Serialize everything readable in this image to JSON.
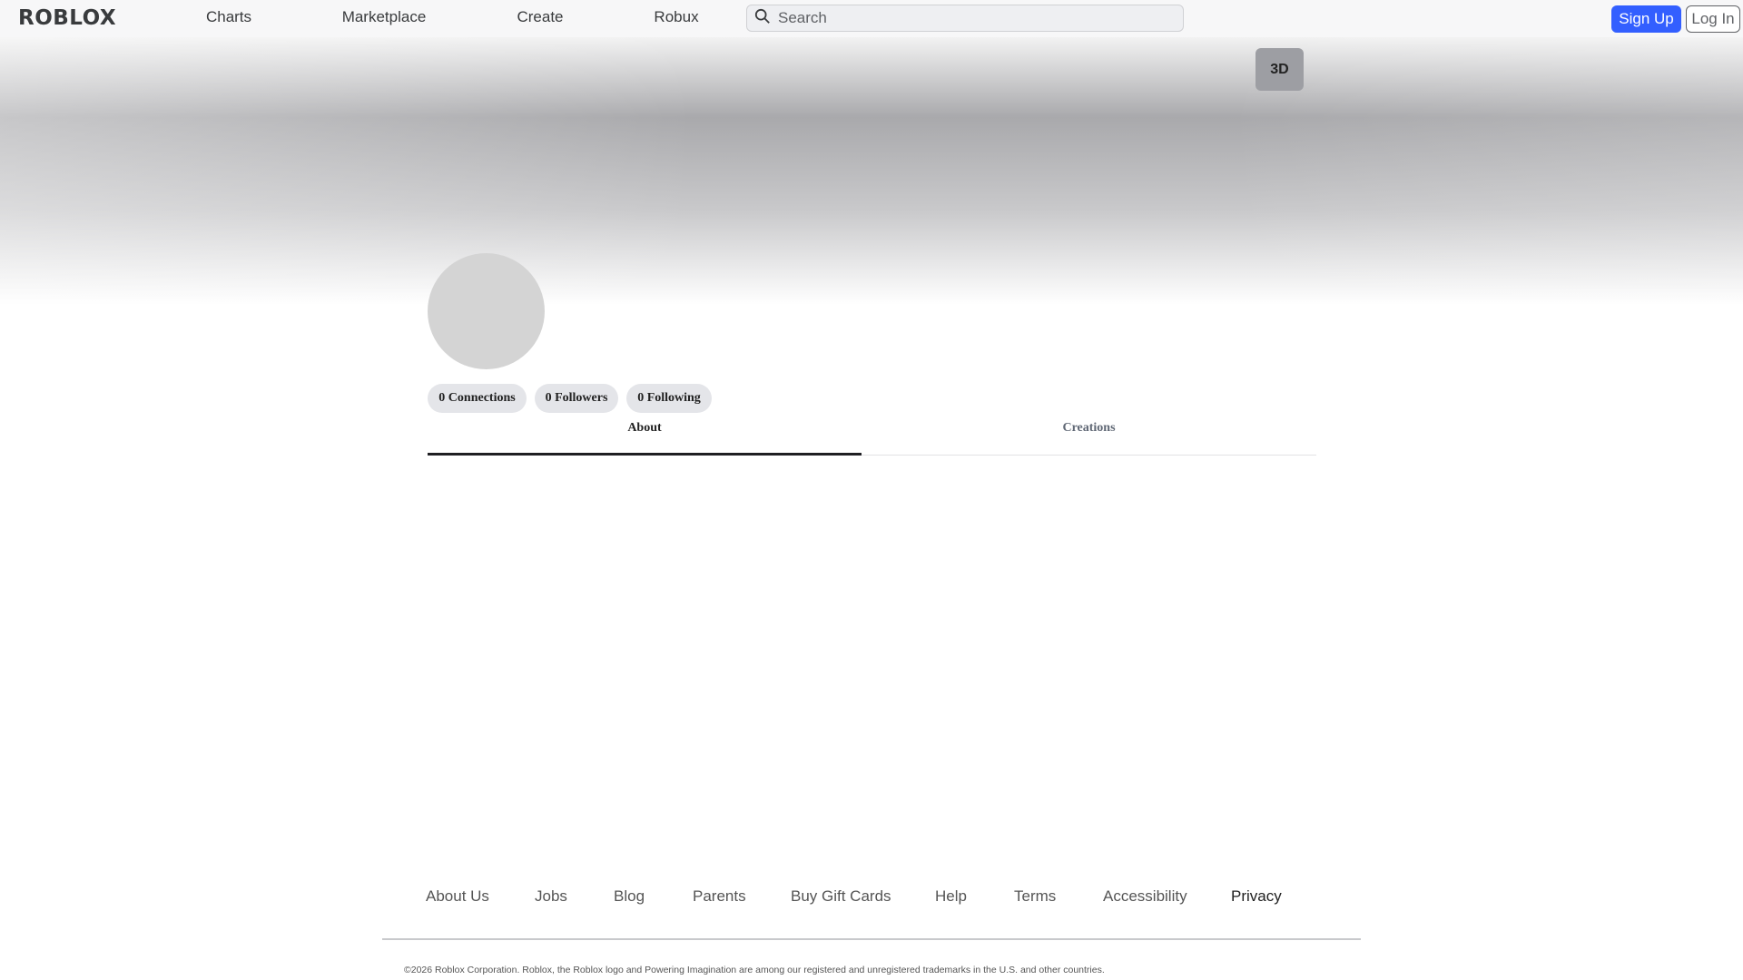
{
  "nav": {
    "logo": "ROBLOX",
    "links": [
      "Charts",
      "Marketplace",
      "Create",
      "Robux"
    ],
    "search_placeholder": "Search",
    "signup": "Sign Up",
    "login": "Log In"
  },
  "profile": {
    "view_3d": "3D",
    "stats": [
      "0 Connections",
      "0 Followers",
      "0 Following"
    ],
    "tabs": [
      "About",
      "Creations"
    ],
    "active_tab": "About"
  },
  "footer": {
    "links": [
      "About Us",
      "Jobs",
      "Blog",
      "Parents",
      "Buy Gift Cards",
      "Help",
      "Terms",
      "Accessibility",
      "Privacy"
    ],
    "copyright": "©2026 Roblox Corporation. Roblox, the Roblox logo and Powering Imagination are among our registered and unregistered trademarks in the U.S. and other countries."
  },
  "colors": {
    "accent": "#335fff",
    "tab_active": "#1f1f23"
  }
}
